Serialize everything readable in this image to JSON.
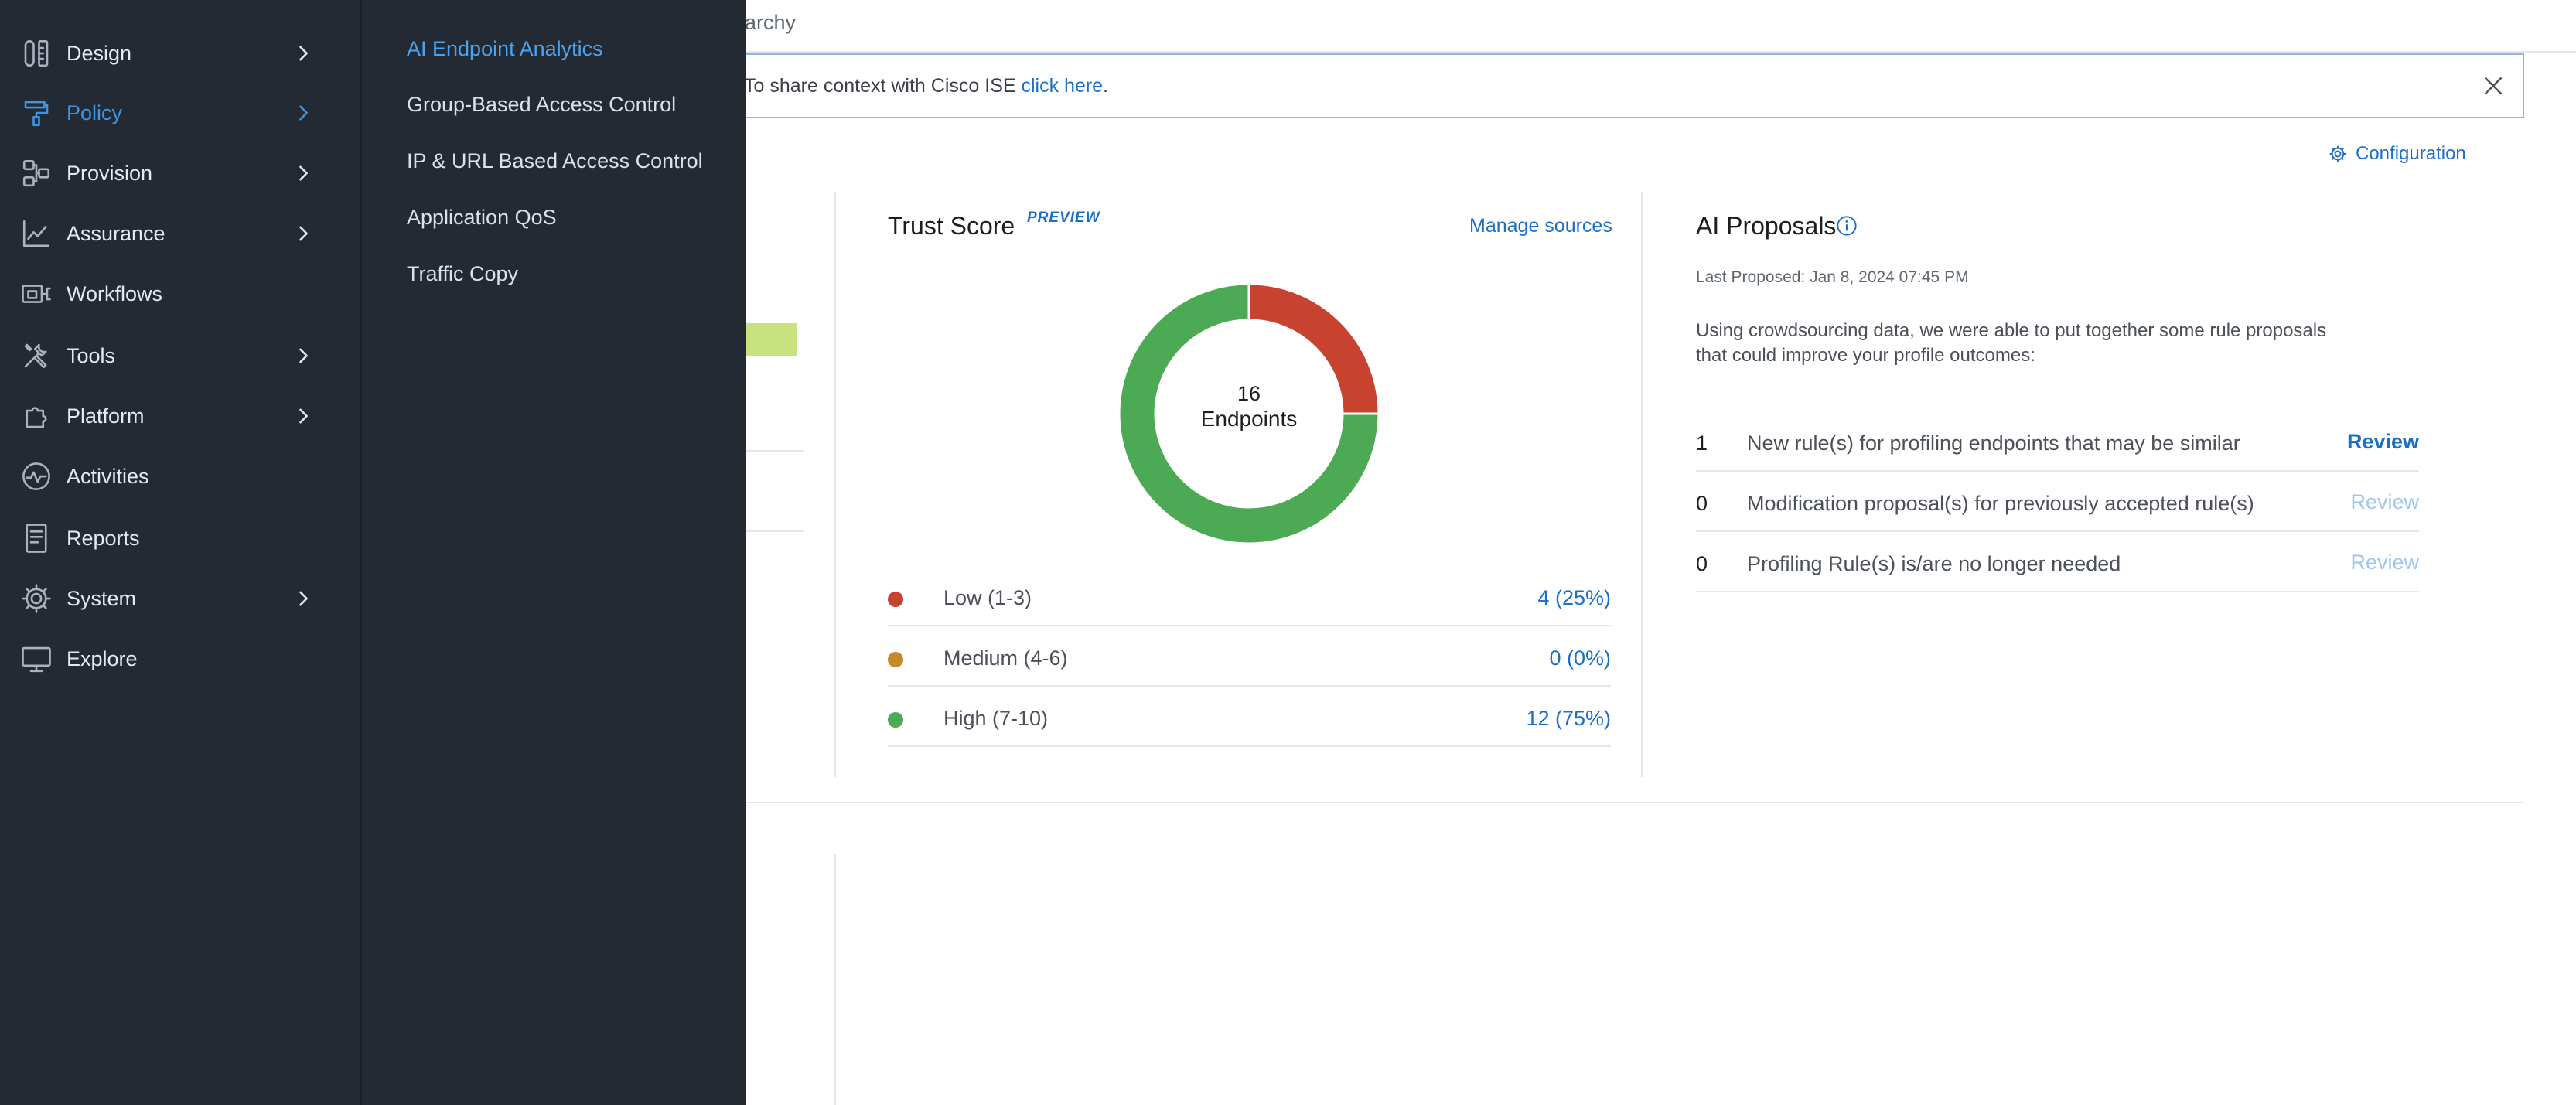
{
  "nav": {
    "items": [
      {
        "label": "Design",
        "icon": "design-icon",
        "chevron": true,
        "active": false
      },
      {
        "label": "Policy",
        "icon": "policy-icon",
        "chevron": true,
        "active": true
      },
      {
        "label": "Provision",
        "icon": "provision-icon",
        "chevron": true,
        "active": false
      },
      {
        "label": "Assurance",
        "icon": "assurance-icon",
        "chevron": true,
        "active": false
      },
      {
        "label": "Workflows",
        "icon": "workflows-icon",
        "chevron": false,
        "active": false
      },
      {
        "label": "Tools",
        "icon": "tools-icon",
        "chevron": true,
        "active": false
      },
      {
        "label": "Platform",
        "icon": "platform-icon",
        "chevron": true,
        "active": false
      },
      {
        "label": "Activities",
        "icon": "activities-icon",
        "chevron": false,
        "active": false
      },
      {
        "label": "Reports",
        "icon": "reports-icon",
        "chevron": false,
        "active": false
      },
      {
        "label": "System",
        "icon": "system-icon",
        "chevron": true,
        "active": false
      },
      {
        "label": "Explore",
        "icon": "explore-icon",
        "chevron": false,
        "active": false
      }
    ]
  },
  "submenu": {
    "items": [
      {
        "label": "AI Endpoint Analytics",
        "active": true
      },
      {
        "label": "Group-Based Access Control",
        "active": false
      },
      {
        "label": "IP & URL Based Access Control",
        "active": false
      },
      {
        "label": "Application QoS",
        "active": false
      },
      {
        "label": "Traffic Copy",
        "active": false
      }
    ]
  },
  "header": {
    "breadcrumb_tail": "archy"
  },
  "banner": {
    "text": "To share context with Cisco ISE ",
    "link": "click here",
    "suffix": "."
  },
  "toolbar": {
    "config_label": "Configuration"
  },
  "trust_score": {
    "title": "Trust Score",
    "badge": "PREVIEW",
    "manage_label": "Manage sources",
    "center_number": "16",
    "center_label": "Endpoints",
    "legend": [
      {
        "label": "Low (1-3)",
        "value": "4 (25%)",
        "color": "#c8432f"
      },
      {
        "label": "Medium (4-6)",
        "value": "0 (0%)",
        "color": "#c48a2a"
      },
      {
        "label": "High (7-10)",
        "value": "12 (75%)",
        "color": "#4caa55"
      }
    ]
  },
  "chart_data": {
    "type": "pie",
    "categories": [
      "Low (1-3)",
      "Medium (4-6)",
      "High (7-10)"
    ],
    "values": [
      4,
      0,
      12
    ],
    "colors": [
      "#c8432f",
      "#c48a2a",
      "#4caa55"
    ],
    "title": "Trust Score",
    "center_text": [
      "16",
      "Endpoints"
    ]
  },
  "ai_proposals": {
    "title": "AI Proposals",
    "last_proposed": "Last Proposed: Jan 8, 2024 07:45 PM",
    "description": "Using crowdsourcing data, we were able to put together some rule proposals that could improve your profile outcomes:",
    "review_label": "Review",
    "rows": [
      {
        "count": "1",
        "text": "New rule(s) for profiling endpoints that may be similar",
        "enabled": true
      },
      {
        "count": "0",
        "text": "Modification proposal(s) for previously accepted rule(s)",
        "enabled": false
      },
      {
        "count": "0",
        "text": "Profiling Rule(s) is/are no longer needed",
        "enabled": false
      }
    ]
  }
}
